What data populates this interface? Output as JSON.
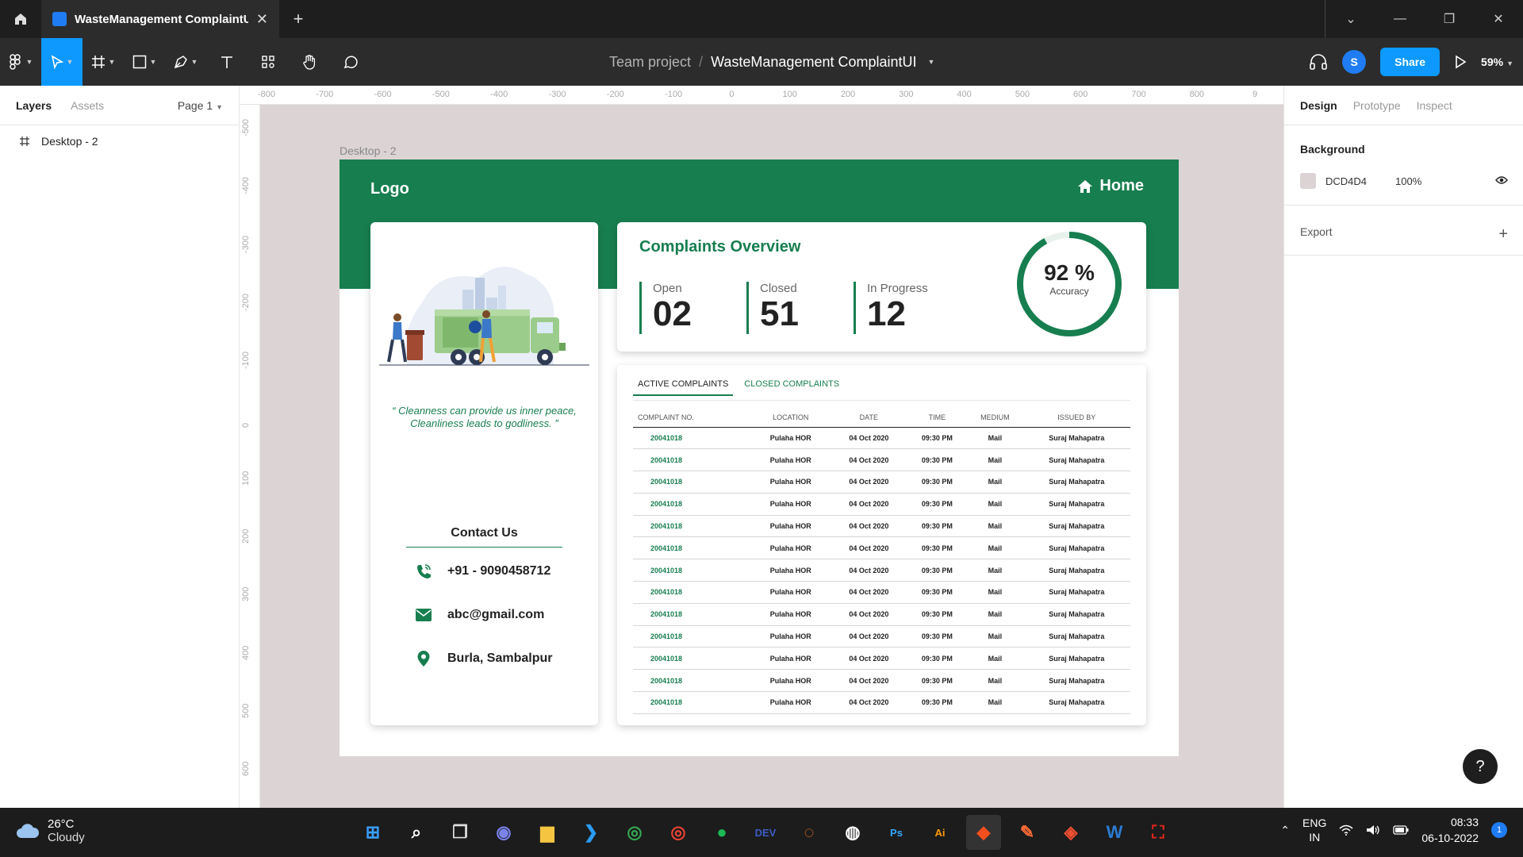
{
  "window": {
    "tab_title": "WasteManagement ComplaintUI",
    "close_glyph": "✕",
    "new_tab_glyph": "+"
  },
  "toolbar": {
    "project": "Team project",
    "separator": "/",
    "file_name": "WasteManagement ComplaintUI",
    "avatar_initial": "S",
    "share_label": "Share",
    "zoom": "59%"
  },
  "left_panel": {
    "tabs": [
      "Layers",
      "Assets"
    ],
    "page": "Page 1",
    "layers": [
      "Desktop - 2"
    ]
  },
  "ruler_top": [
    "-800",
    "-700",
    "-600",
    "-500",
    "-400",
    "-300",
    "-200",
    "-100",
    "0",
    "100",
    "200",
    "300",
    "400",
    "500",
    "600",
    "700",
    "800",
    "9"
  ],
  "ruler_left": [
    "-500",
    "-400",
    "-300",
    "-200",
    "-100",
    "0",
    "100",
    "200",
    "300",
    "400",
    "500",
    "600"
  ],
  "canvas": {
    "background": "#dcd4d4",
    "frame_label": "Desktop - 2"
  },
  "design": {
    "accent": "#177e4f",
    "logo": "Logo",
    "home": "Home",
    "quote": "“ Cleanness can provide us inner peace, Cleanliness leads to godliness. ”",
    "contact": {
      "title": "Contact Us",
      "phone": "+91 - 9090458712",
      "email": "abc@gmail.com",
      "address": "Burla, Sambalpur"
    },
    "overview": {
      "title": "Complaints Overview",
      "stats": [
        {
          "label": "Open",
          "value": "02"
        },
        {
          "label": "Closed",
          "value": "51"
        },
        {
          "label": "In Progress",
          "value": "12"
        }
      ],
      "accuracy_value": "92 %",
      "accuracy_label": "Accuracy",
      "accuracy_fraction": 0.92
    },
    "table": {
      "tabs": [
        "ACTIVE COMPLAINTS",
        "CLOSED COMPLAINTS"
      ],
      "headers": [
        "COMPLAINT NO.",
        "LOCATION",
        "DATE",
        "TIME",
        "MEDIUM",
        "ISSUED BY"
      ],
      "rows": [
        [
          "20041018",
          "Pulaha HOR",
          "04 Oct 2020",
          "09:30 PM",
          "Mail",
          "Suraj Mahapatra"
        ],
        [
          "20041018",
          "Pulaha HOR",
          "04 Oct 2020",
          "09:30 PM",
          "Mail",
          "Suraj Mahapatra"
        ],
        [
          "20041018",
          "Pulaha HOR",
          "04 Oct 2020",
          "09:30 PM",
          "Mail",
          "Suraj Mahapatra"
        ],
        [
          "20041018",
          "Pulaha HOR",
          "04 Oct 2020",
          "09:30 PM",
          "Mail",
          "Suraj Mahapatra"
        ],
        [
          "20041018",
          "Pulaha HOR",
          "04 Oct 2020",
          "09:30 PM",
          "Mail",
          "Suraj Mahapatra"
        ],
        [
          "20041018",
          "Pulaha HOR",
          "04 Oct 2020",
          "09:30 PM",
          "Mail",
          "Suraj Mahapatra"
        ],
        [
          "20041018",
          "Pulaha HOR",
          "04 Oct 2020",
          "09:30 PM",
          "Mail",
          "Suraj Mahapatra"
        ],
        [
          "20041018",
          "Pulaha HOR",
          "04 Oct 2020",
          "09:30 PM",
          "Mail",
          "Suraj Mahapatra"
        ],
        [
          "20041018",
          "Pulaha HOR",
          "04 Oct 2020",
          "09:30 PM",
          "Mail",
          "Suraj Mahapatra"
        ],
        [
          "20041018",
          "Pulaha HOR",
          "04 Oct 2020",
          "09:30 PM",
          "Mail",
          "Suraj Mahapatra"
        ],
        [
          "20041018",
          "Pulaha HOR",
          "04 Oct 2020",
          "09:30 PM",
          "Mail",
          "Suraj Mahapatra"
        ],
        [
          "20041018",
          "Pulaha HOR",
          "04 Oct 2020",
          "09:30 PM",
          "Mail",
          "Suraj Mahapatra"
        ],
        [
          "20041018",
          "Pulaha HOR",
          "04 Oct 2020",
          "09:30 PM",
          "Mail",
          "Suraj Mahapatra"
        ]
      ]
    }
  },
  "right_panel": {
    "tabs": [
      "Design",
      "Prototype",
      "Inspect"
    ],
    "background_title": "Background",
    "background_hex": "DCD4D4",
    "background_opacity": "100%",
    "export_label": "Export",
    "add_glyph": "+"
  },
  "help_glyph": "?",
  "taskbar": {
    "temperature": "26°C",
    "condition": "Cloudy",
    "apps": [
      {
        "name": "start-icon",
        "glyph": "⊞",
        "color": "#3aa0ff"
      },
      {
        "name": "search-icon",
        "glyph": "⌕",
        "color": "#ffffff"
      },
      {
        "name": "task-view-icon",
        "glyph": "❐",
        "color": "#dddddd"
      },
      {
        "name": "chat-icon",
        "glyph": "◉",
        "color": "#7b83eb"
      },
      {
        "name": "file-explorer-icon",
        "glyph": "▆",
        "color": "#f5c542"
      },
      {
        "name": "vscode-icon",
        "glyph": "❯",
        "color": "#2a9df4"
      },
      {
        "name": "chrome-icon",
        "glyph": "◎",
        "color": "#34a853"
      },
      {
        "name": "chrome-profile-icon",
        "glyph": "◎",
        "color": "#ea4335"
      },
      {
        "name": "spotify-icon",
        "glyph": "●",
        "color": "#1db954"
      },
      {
        "name": "devc-icon",
        "glyph": "DEV",
        "color": "#3b5cc4"
      },
      {
        "name": "jupyter-icon",
        "glyph": "◌",
        "color": "#f37726"
      },
      {
        "name": "wps-icon",
        "glyph": "◍",
        "color": "#ffffff"
      },
      {
        "name": "photoshop-icon",
        "glyph": "Ps",
        "color": "#31a8ff"
      },
      {
        "name": "illustrator-icon",
        "glyph": "Ai",
        "color": "#ff9a00"
      },
      {
        "name": "figma-icon",
        "glyph": "◆",
        "color": "#f24e1e"
      },
      {
        "name": "postman-icon",
        "glyph": "✎",
        "color": "#ff6c37"
      },
      {
        "name": "git-icon",
        "glyph": "◈",
        "color": "#f05032"
      },
      {
        "name": "word-icon",
        "glyph": "W",
        "color": "#2b7cd3"
      },
      {
        "name": "acrobat-icon",
        "glyph": "⛶",
        "color": "#e1251b"
      }
    ],
    "lang_top": "ENG",
    "lang_bottom": "IN",
    "time": "08:33",
    "date": "06-10-2022",
    "notification_count": "1"
  }
}
